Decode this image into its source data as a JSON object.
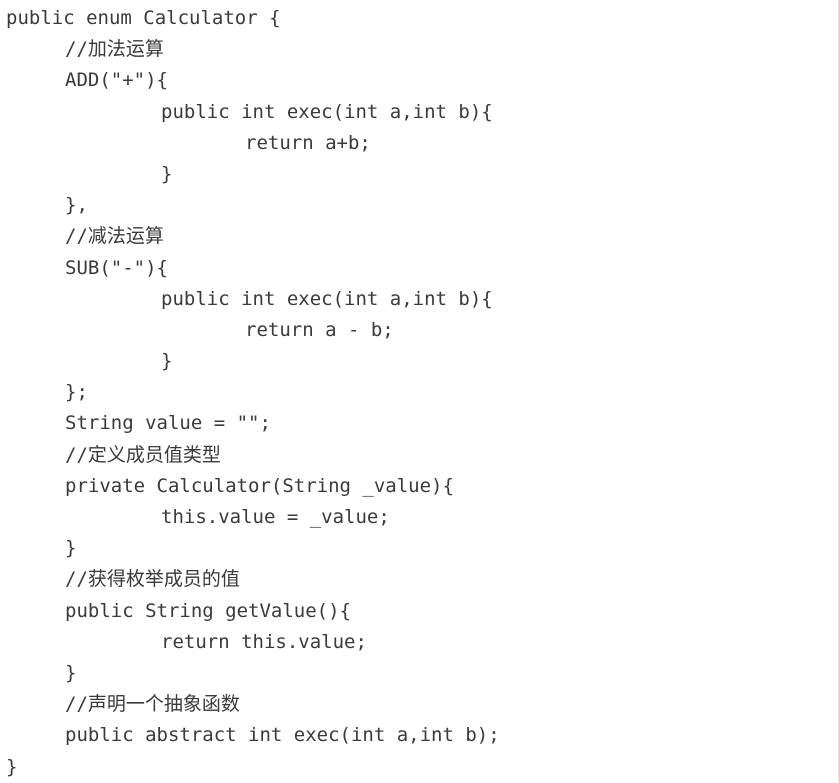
{
  "lines": [
    {
      "indent": 0,
      "text": "public enum Calculator {"
    },
    {
      "indent": 1,
      "text": "//加法运算"
    },
    {
      "indent": 1,
      "text": "ADD(\"+\"){"
    },
    {
      "indent": 2,
      "text": "public int exec(int a,int b){"
    },
    {
      "indent": 3,
      "text": "return a+b;"
    },
    {
      "indent": 2,
      "text": "}"
    },
    {
      "indent": 1,
      "text": "},"
    },
    {
      "indent": 1,
      "text": "//减法运算"
    },
    {
      "indent": 1,
      "text": "SUB(\"-\"){"
    },
    {
      "indent": 2,
      "text": "public int exec(int a,int b){"
    },
    {
      "indent": 3,
      "text": "return a - b;"
    },
    {
      "indent": 2,
      "text": "}"
    },
    {
      "indent": 1,
      "text": "};"
    },
    {
      "indent": 1,
      "text": "String value = \"\";"
    },
    {
      "indent": 1,
      "text": "//定义成员值类型"
    },
    {
      "indent": 1,
      "text": "private Calculator(String _value){"
    },
    {
      "indent": 2,
      "text": "this.value = _value;"
    },
    {
      "indent": 1,
      "text": "}"
    },
    {
      "indent": 1,
      "text": "//获得枚举成员的值"
    },
    {
      "indent": 1,
      "text": "public String getValue(){"
    },
    {
      "indent": 2,
      "text": "return this.value;"
    },
    {
      "indent": 1,
      "text": "}"
    },
    {
      "indent": 1,
      "text": "//声明一个抽象函数"
    },
    {
      "indent": 1,
      "text": "public abstract int exec(int a,int b);"
    },
    {
      "indent": 0,
      "text": "}"
    }
  ]
}
